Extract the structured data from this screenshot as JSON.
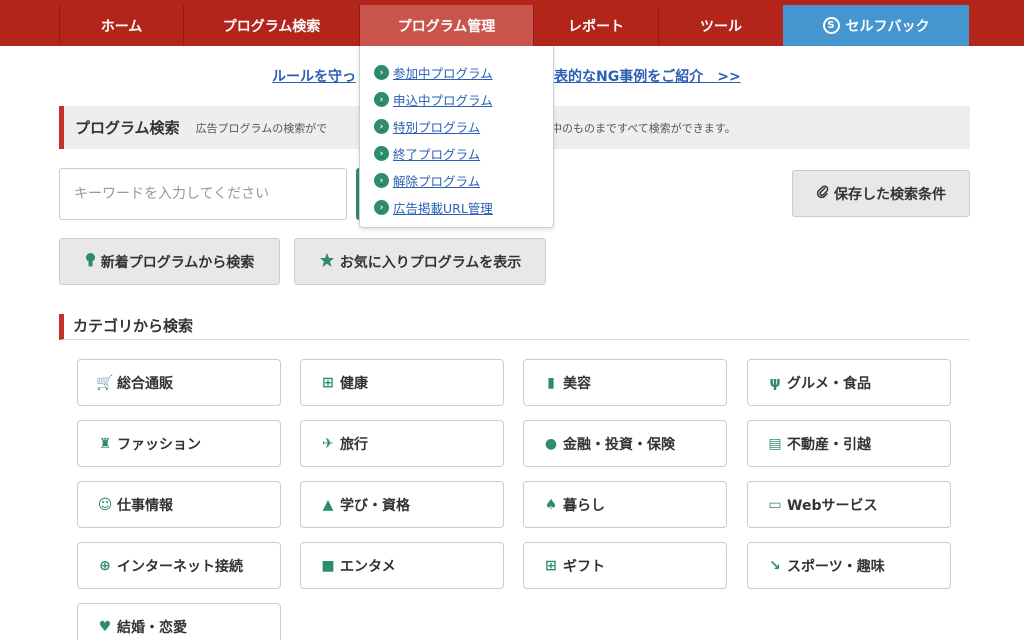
{
  "nav": {
    "home": "ホーム",
    "search": "プログラム検索",
    "manage": "プログラム管理",
    "report": "レポート",
    "tool": "ツール",
    "selfback": "セルフバック",
    "selfback_icon_letter": "S"
  },
  "notice": {
    "left": "ルールを守っ",
    "right": "表的なNG事例をご紹介　>>"
  },
  "search_section": {
    "title": "プログラム検索",
    "desc_left": "広告プログラムの検索がで",
    "desc_right": "中のものまですべて検索ができます。",
    "keyword_placeholder": "キーワードを入力してください",
    "saved_button": "保存した検索条件",
    "new_programs_button": "新着プログラムから検索",
    "favorites_button": "お気に入りプログラムを表示"
  },
  "dropdown": {
    "items": [
      "参加中プログラム",
      "申込中プログラム",
      "特別プログラム",
      "終了プログラム",
      "解除プログラム",
      "広告掲載URL管理"
    ]
  },
  "categories": {
    "heading": "カテゴリから検索",
    "items": [
      {
        "label": "総合通販",
        "icon": "cart-icon"
      },
      {
        "label": "健康",
        "icon": "first-aid-icon"
      },
      {
        "label": "美容",
        "icon": "lipstick-icon"
      },
      {
        "label": "グルメ・食品",
        "icon": "fork-knife-icon"
      },
      {
        "label": "ファッション",
        "icon": "dress-icon"
      },
      {
        "label": "旅行",
        "icon": "airplane-icon"
      },
      {
        "label": "金融・投資・保険",
        "icon": "money-bag-icon"
      },
      {
        "label": "不動産・引越",
        "icon": "store-icon"
      },
      {
        "label": "仕事情報",
        "icon": "person-icon"
      },
      {
        "label": "学び・資格",
        "icon": "graduation-cap-icon"
      },
      {
        "label": "暮らし",
        "icon": "lamp-icon"
      },
      {
        "label": "Webサービス",
        "icon": "monitor-icon"
      },
      {
        "label": "インターネット接続",
        "icon": "globe-icon"
      },
      {
        "label": "エンタメ",
        "icon": "camera-icon"
      },
      {
        "label": "ギフト",
        "icon": "gift-icon"
      },
      {
        "label": "スポーツ・趣味",
        "icon": "wrench-icon"
      },
      {
        "label": "結婚・恋愛",
        "icon": "heart-icon"
      }
    ]
  },
  "colors": {
    "nav_red": "#b3251b",
    "nav_active": "#c9544b",
    "selfback_blue": "#4596ce",
    "accent_green": "#2e8b6e",
    "link_blue": "#2b5fb4"
  }
}
